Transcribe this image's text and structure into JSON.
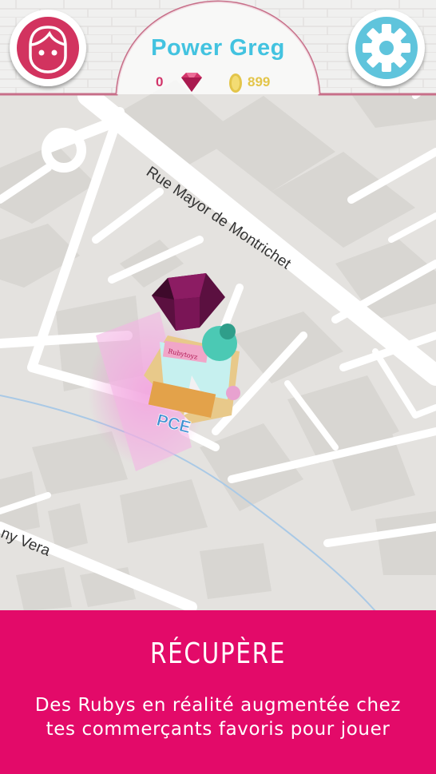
{
  "header": {
    "player_name": "Power Greg",
    "ruby_count": "0",
    "coin_count": "899",
    "profile_icon": "face-icon",
    "settings_icon": "gear-icon"
  },
  "map": {
    "street_1": "Rue Mayor de Montrichet",
    "street_2": "ny Vera",
    "store_label": "PCE",
    "store_sign": "Rubytoyz"
  },
  "panel": {
    "title": "RÉCUPÈRE",
    "description_line1": "Des Rubys en réalité augmentée chez",
    "description_line2": "tes commerçants favoris pour jouer"
  },
  "colors": {
    "accent_pink": "#e30a69",
    "profile_pink": "#d2335f",
    "settings_blue": "#5fc4dc",
    "name_cyan": "#43c3e0",
    "coin_gold": "#e3c54a"
  }
}
